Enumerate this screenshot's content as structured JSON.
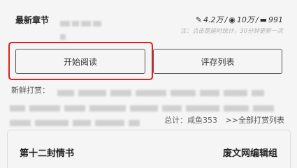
{
  "header": {
    "latest_label": "最新章节",
    "stats": {
      "words": "4.2万",
      "views": "10万",
      "comments": "991"
    },
    "note": "注：点击是延时统计，30分钟更新一次"
  },
  "buttons": {
    "start_reading": "开始阅读",
    "reviews": "评存列表"
  },
  "rewards": {
    "label": "新鲜打赏：",
    "total": "总计：咸鱼353",
    "all_link": ">>全部打赏列表"
  },
  "chapter": {
    "title": "第十二封情书",
    "group": "废文网编辑组"
  },
  "colors": {
    "highlight": "#e02020"
  }
}
